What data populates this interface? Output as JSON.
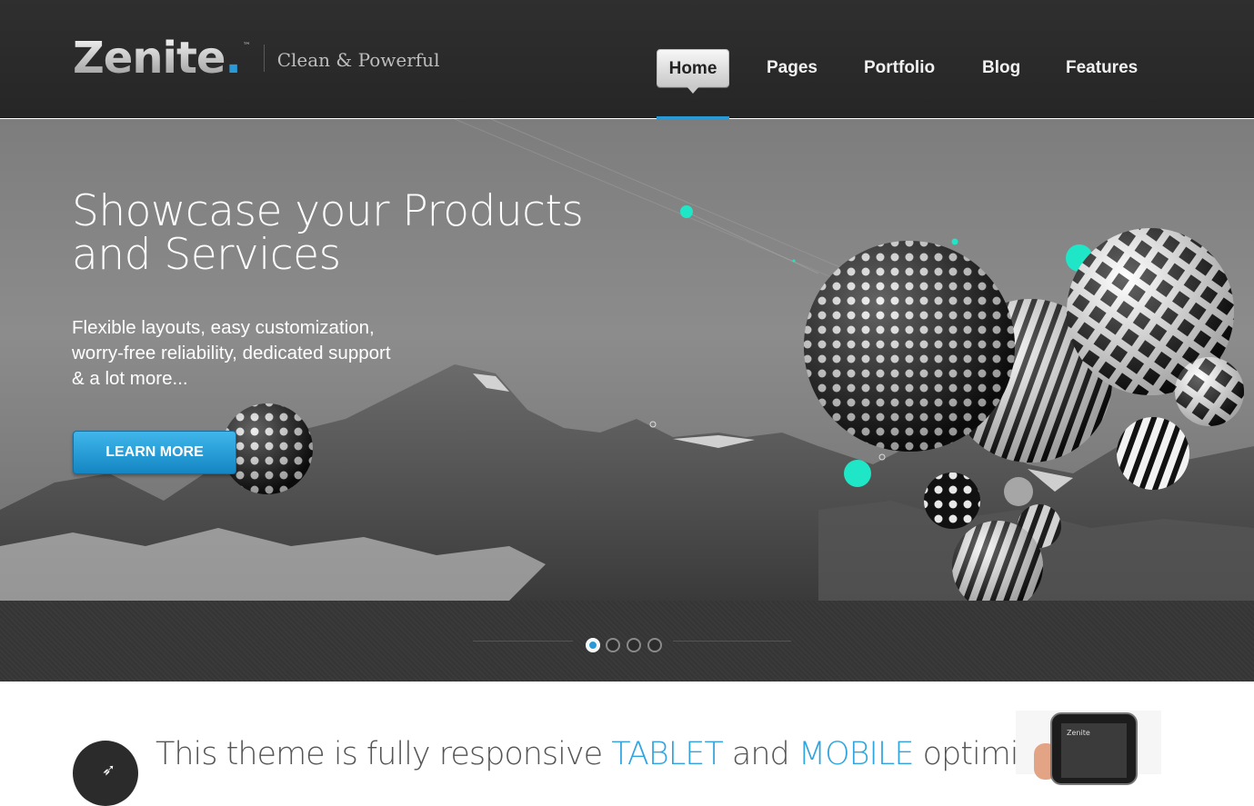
{
  "header": {
    "logo": "Zenite",
    "logo_tm": "™",
    "tagline": "Clean & Powerful",
    "nav": [
      {
        "label": "Home",
        "active": true
      },
      {
        "label": "Pages"
      },
      {
        "label": "Portfolio"
      },
      {
        "label": "Blog"
      },
      {
        "label": "Features"
      }
    ]
  },
  "hero": {
    "title_line1": "Showcase your Products",
    "title_line2": "and Services",
    "text_line1": "Flexible layouts, easy customization,",
    "text_line2": "worry-free reliability, dedicated support",
    "text_line3": "& a lot more...",
    "button": "LEARN MORE"
  },
  "slider": {
    "slide_count": 4,
    "active_slide": 1
  },
  "promo": {
    "part1": "This theme is fully responsive ",
    "hl1": "TABLET",
    "part2": " and ",
    "hl2": "MOBILE",
    "part3": " optimized.",
    "phone_screen": "Zenite"
  },
  "colors": {
    "accent": "#2a9ad7",
    "header_bg": "#2b2b2b",
    "highlight_text": "#2fa4df",
    "sphere_teal": "#1fe6c6"
  },
  "icons": {
    "round_icon": "arrow-icon"
  }
}
